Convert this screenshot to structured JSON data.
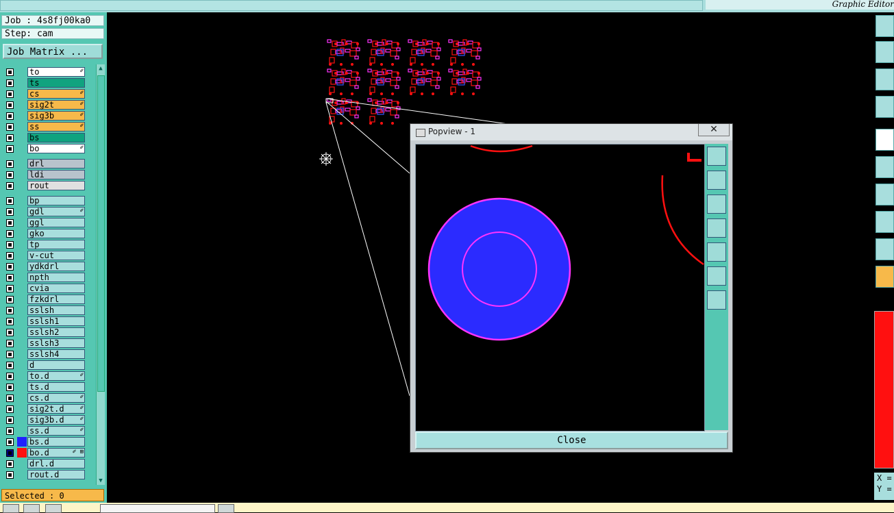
{
  "app": {
    "title": "Graphic Editor"
  },
  "job": {
    "label": "Job : 4s8fj00ka0",
    "step": "Step: cam",
    "matrix_button": "Job Matrix ..."
  },
  "layers": [
    {
      "name": "to",
      "bg": "#ffffff",
      "mark": "✐"
    },
    {
      "name": "ts",
      "bg": "#10a37f",
      "mark": ""
    },
    {
      "name": "cs",
      "bg": "#f7b94a",
      "mark": "✐"
    },
    {
      "name": "sig2t",
      "bg": "#f7b94a",
      "mark": "✐"
    },
    {
      "name": "sig3b",
      "bg": "#f7b94a",
      "mark": "✐"
    },
    {
      "name": "ss",
      "bg": "#f7b94a",
      "mark": "✐"
    },
    {
      "name": "bs",
      "bg": "#10a37f",
      "mark": ""
    },
    {
      "name": "bo",
      "bg": "#ffffff",
      "mark": "✐"
    },
    {
      "name": "drl",
      "bg": "#b8c3cc",
      "mark": ""
    },
    {
      "name": "ldi",
      "bg": "#b8c3cc",
      "mark": ""
    },
    {
      "name": "rout",
      "bg": "#e0e0e0",
      "mark": ""
    },
    {
      "name": "bp",
      "bg": "#a8dedd",
      "mark": ""
    },
    {
      "name": "gdl",
      "bg": "#a8dedd",
      "mark": "✐"
    },
    {
      "name": "ggl",
      "bg": "#a8dedd",
      "mark": ""
    },
    {
      "name": "gko",
      "bg": "#a8dedd",
      "mark": ""
    },
    {
      "name": "tp",
      "bg": "#a8dedd",
      "mark": ""
    },
    {
      "name": "v-cut",
      "bg": "#a8dedd",
      "mark": ""
    },
    {
      "name": "ydkdrl",
      "bg": "#a8dedd",
      "mark": ""
    },
    {
      "name": "npth",
      "bg": "#a8dedd",
      "mark": ""
    },
    {
      "name": "cvia",
      "bg": "#a8dedd",
      "mark": ""
    },
    {
      "name": "fzkdrl",
      "bg": "#a8dedd",
      "mark": ""
    },
    {
      "name": "sslsh",
      "bg": "#a8dedd",
      "mark": ""
    },
    {
      "name": "sslsh1",
      "bg": "#a8dedd",
      "mark": ""
    },
    {
      "name": "sslsh2",
      "bg": "#a8dedd",
      "mark": ""
    },
    {
      "name": "sslsh3",
      "bg": "#a8dedd",
      "mark": ""
    },
    {
      "name": "sslsh4",
      "bg": "#a8dedd",
      "mark": ""
    },
    {
      "name": "d",
      "bg": "#a8dedd",
      "mark": ""
    },
    {
      "name": "to.d",
      "bg": "#a8dedd",
      "mark": "✐"
    },
    {
      "name": "ts.d",
      "bg": "#a8dedd",
      "mark": ""
    },
    {
      "name": "cs.d",
      "bg": "#a8dedd",
      "mark": "✐"
    },
    {
      "name": "sig2t.d",
      "bg": "#a8dedd",
      "mark": "✐"
    },
    {
      "name": "sig3b.d",
      "bg": "#a8dedd",
      "mark": "✐"
    },
    {
      "name": "ss.d",
      "bg": "#a8dedd",
      "mark": "✐"
    },
    {
      "name": "bs.d",
      "bg": "#a8dedd",
      "mark": "",
      "color": "#2020ff"
    },
    {
      "name": "bo.d",
      "bg": "#a8dedd",
      "mark": "✐ ⊞",
      "color": "#ff1010",
      "active": true
    },
    {
      "name": "drl.d",
      "bg": "#a8dedd",
      "mark": ""
    },
    {
      "name": "rout.d",
      "bg": "#a8dedd",
      "mark": ""
    }
  ],
  "status": {
    "selected": "Selected : 0"
  },
  "popview": {
    "title": "Popview - 1",
    "close_x": "✕",
    "close_button": "Close"
  },
  "coords": {
    "x_label": "X =",
    "y_label": "Y ="
  },
  "colors": {
    "panel": "#55c7b2",
    "highlight": "#f7b94a",
    "pad_blue": "#2b2bff",
    "pad_ring": "#ff33ff",
    "trace_red": "#ff1010"
  },
  "icons": {
    "snap": "crosshair-icon"
  }
}
